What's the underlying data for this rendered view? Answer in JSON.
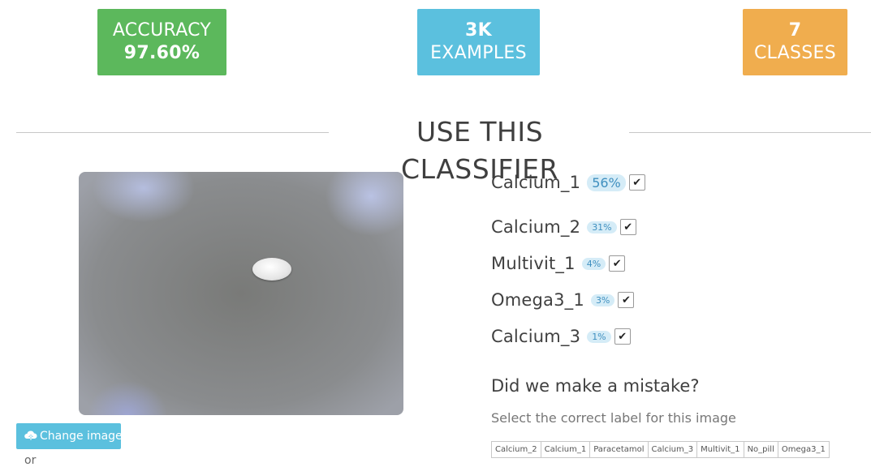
{
  "stats": {
    "accuracy": {
      "label": "ACCURACY",
      "value": "97.60%"
    },
    "examples": {
      "value": "3K",
      "label": "EXAMPLES"
    },
    "classes": {
      "value": "7",
      "label": "CLASSES"
    }
  },
  "section_title": "USE THIS CLASSIFIER",
  "image": {
    "change_label": "Change image",
    "or_text": "or"
  },
  "predictions": [
    {
      "name": "Calcium_1",
      "percent": "56%"
    },
    {
      "name": "Calcium_2",
      "percent": "31%"
    },
    {
      "name": "Multivit_1",
      "percent": "4%"
    },
    {
      "name": "Omega3_1",
      "percent": "3%"
    },
    {
      "name": "Calcium_3",
      "percent": "1%"
    }
  ],
  "mistake": {
    "question": "Did we make a mistake?",
    "hint": "Select the correct label for this image",
    "labels": [
      "Calcium_2",
      "Calcium_1",
      "Paracetamol",
      "Calcium_3",
      "Multivit_1",
      "No_pill",
      "Omega3_1"
    ]
  },
  "colors": {
    "accuracy": "#5cb85c",
    "examples": "#5bc0de",
    "classes": "#f0ad4e",
    "badge_bg": "#d5ecf7"
  },
  "icons": {
    "change_image": "cloud-upload-icon",
    "checkbox": "check-icon"
  }
}
